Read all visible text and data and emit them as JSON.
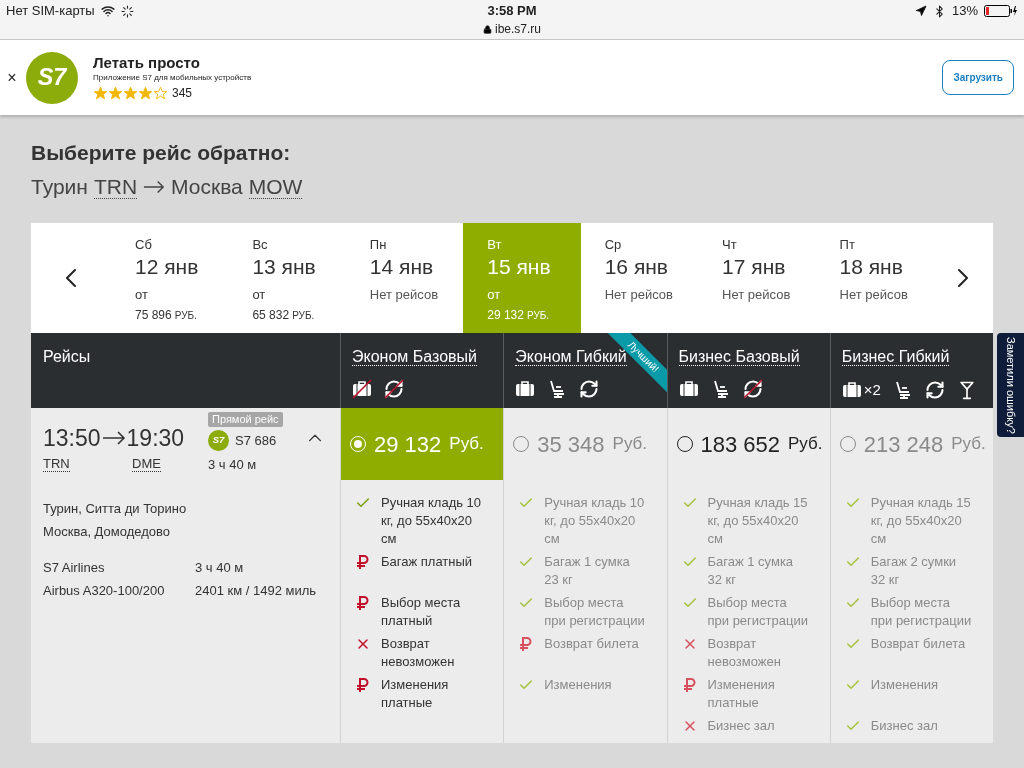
{
  "status_bar": {
    "carrier": "Нет SIM-карты",
    "time": "3:58 PM",
    "url": "ibe.s7.ru",
    "battery": "13%"
  },
  "banner": {
    "close": "×",
    "logo_text": "S7",
    "title": "Летать просто",
    "subtitle": "Приложение S7 для мобильных устройств",
    "stars": 4,
    "rating_count": "345",
    "button": "Загрузить"
  },
  "heading": "Выберите рейс обратно:",
  "route": {
    "from_city": "Турин",
    "from_code": "TRN",
    "to_city": "Москва",
    "to_code": "MOW"
  },
  "dates": [
    {
      "weekday": "Сб",
      "date": "12 янв",
      "kind": "price",
      "from": "от",
      "price": "75 896",
      "currency": "РУБ.",
      "selected": false
    },
    {
      "weekday": "Вс",
      "date": "13 янв",
      "kind": "price",
      "from": "от",
      "price": "65 832",
      "currency": "РУБ.",
      "selected": false
    },
    {
      "weekday": "Пн",
      "date": "14 янв",
      "kind": "none",
      "note": "Нет рейсов",
      "selected": false
    },
    {
      "weekday": "Вт",
      "date": "15 янв",
      "kind": "price",
      "from": "от",
      "price": "29 132",
      "currency": "РУБ.",
      "selected": true
    },
    {
      "weekday": "Ср",
      "date": "16 янв",
      "kind": "none",
      "note": "Нет рейсов",
      "selected": false
    },
    {
      "weekday": "Чт",
      "date": "17 янв",
      "kind": "none",
      "note": "Нет рейсов",
      "selected": false
    },
    {
      "weekday": "Пт",
      "date": "18 янв",
      "kind": "none",
      "note": "Нет рейсов",
      "selected": false
    }
  ],
  "table": {
    "flights_heading": "Рейсы",
    "fares": [
      {
        "title": "Эконом Базовый",
        "selected": true,
        "dimmed": false,
        "price": "29 132",
        "currency": "Руб.",
        "icons": [
          {
            "kind": "bag",
            "crossed": true
          },
          {
            "kind": "refresh",
            "crossed": true
          }
        ],
        "features": [
          {
            "kind": "check",
            "text": "Ручная кладь 10 кг, до 55x40x20 см"
          },
          {
            "kind": "paid",
            "text": "Багаж платный"
          },
          {
            "kind": "paid",
            "text": "Выбор места платный"
          },
          {
            "kind": "no",
            "text": "Возврат невозможен"
          },
          {
            "kind": "paid",
            "text": "Изменения платные"
          }
        ]
      },
      {
        "title": "Эконом Гибкий",
        "selected": false,
        "dimmed": true,
        "ribbon": "Лучший!",
        "price": "35 348",
        "currency": "Руб.",
        "icons": [
          {
            "kind": "bag",
            "crossed": false
          },
          {
            "kind": "seat",
            "crossed": false
          },
          {
            "kind": "refresh",
            "crossed": false
          }
        ],
        "features": [
          {
            "kind": "check",
            "text": "Ручная кладь 10 кг, до 55x40x20 см"
          },
          {
            "kind": "check",
            "text": "Багаж 1 сумка 23 кг"
          },
          {
            "kind": "check",
            "text": "Выбор места при регистрации"
          },
          {
            "kind": "paid",
            "text": "Возврат билета"
          },
          {
            "kind": "check",
            "text": "Изменения"
          }
        ]
      },
      {
        "title": "Бизнес Базовый",
        "selected": false,
        "dimmed": false,
        "price": "183 652",
        "currency": "Руб.",
        "icons": [
          {
            "kind": "bag",
            "crossed": false
          },
          {
            "kind": "seat",
            "crossed": false
          },
          {
            "kind": "refresh",
            "crossed": true
          }
        ],
        "features": [
          {
            "kind": "check",
            "text": "Ручная кладь 15 кг, до 55x40x20 см"
          },
          {
            "kind": "check",
            "text": "Багаж 1 сумка 32 кг"
          },
          {
            "kind": "check",
            "text": "Выбор места при регистрации"
          },
          {
            "kind": "no",
            "text": "Возврат невозможен"
          },
          {
            "kind": "paid",
            "text": "Изменения платные"
          },
          {
            "kind": "no",
            "text": "Бизнес зал"
          }
        ]
      },
      {
        "title": "Бизнес Гибкий",
        "selected": false,
        "dimmed": true,
        "price": "213 248",
        "currency": "Руб.",
        "icons": [
          {
            "kind": "bag",
            "crossed": false,
            "count": "×2"
          },
          {
            "kind": "seat",
            "crossed": false
          },
          {
            "kind": "refresh",
            "crossed": false
          },
          {
            "kind": "cocktail",
            "crossed": false
          }
        ],
        "features": [
          {
            "kind": "check",
            "text": "Ручная кладь 15 кг, до 55x40x20 см"
          },
          {
            "kind": "check",
            "text": "Багаж 2 сумки 32 кг"
          },
          {
            "kind": "check",
            "text": "Выбор места при регистрации"
          },
          {
            "kind": "check",
            "text": "Возврат билета"
          },
          {
            "kind": "check",
            "text": "Изменения"
          },
          {
            "kind": "check",
            "text": "Бизнес зал"
          }
        ]
      }
    ],
    "flight": {
      "departure": "13:50",
      "arrival": "19:30",
      "from_code": "TRN",
      "to_code": "DME",
      "badge": "Прямой рейс",
      "logo_text": "S7",
      "number": "S7 686",
      "duration": "3 ч 40 м",
      "expanded": true,
      "from_airport": "Турин, Ситта ди Торино",
      "to_airport": "Москва, Домодедово",
      "airline": "S7 Airlines",
      "airline_duration": "3 ч 40 м",
      "aircraft": "Airbus A320-100/200",
      "distance": "2401 км / 1492 миль"
    }
  },
  "feedback_tab": "Заметили ошибку?"
}
